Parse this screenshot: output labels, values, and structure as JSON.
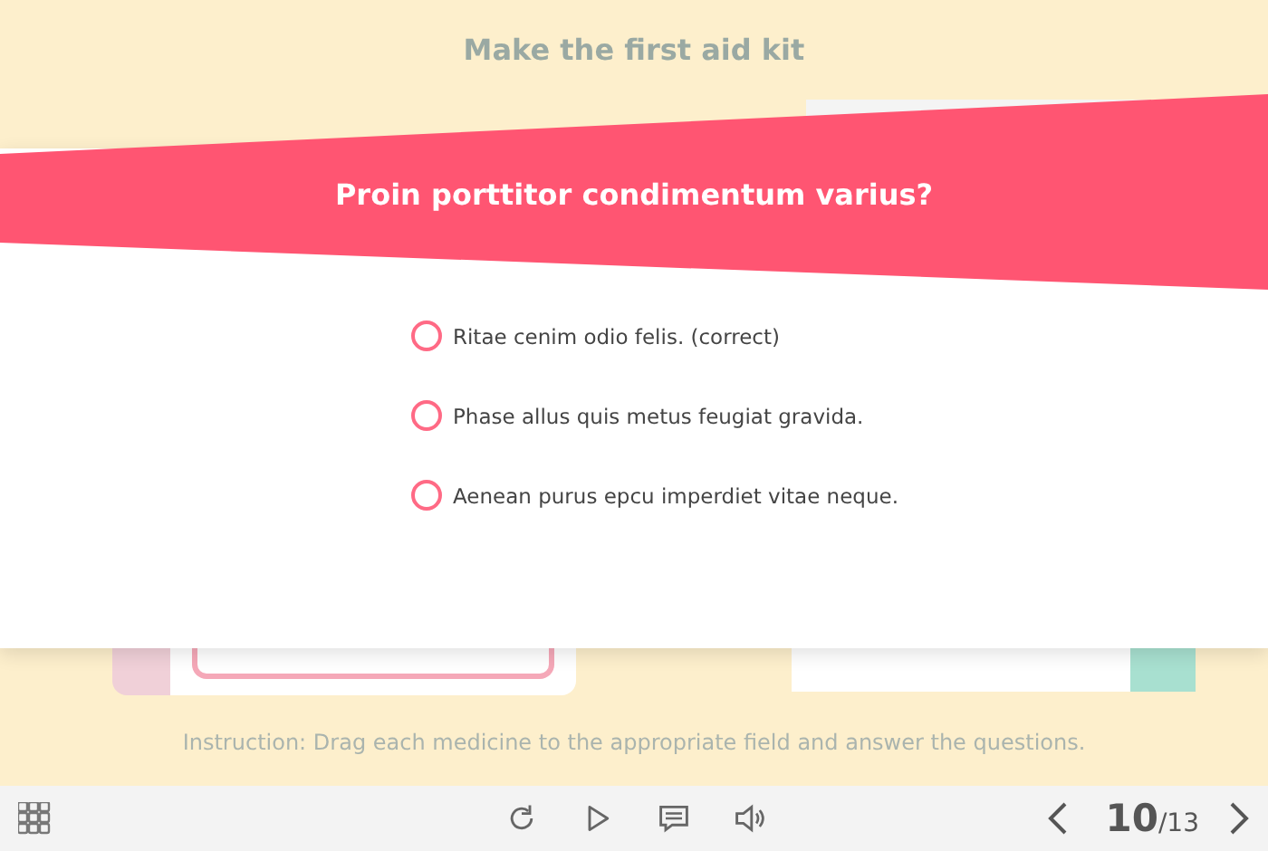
{
  "slide": {
    "title": "Make the first aid kit",
    "instruction": "Instruction: Drag each medicine to the appropriate field and answer the questions."
  },
  "question": {
    "text": "Proin porttitor condimentum varius?",
    "options": [
      {
        "label": "Ritae cenim odio felis. (correct)",
        "selected": false
      },
      {
        "label": "Phase allus quis metus feugiat gravida.",
        "selected": false
      },
      {
        "label": "Aenean purus epcu imperdiet vitae neque.",
        "selected": false
      }
    ]
  },
  "player": {
    "current": "10",
    "total": "/13"
  }
}
